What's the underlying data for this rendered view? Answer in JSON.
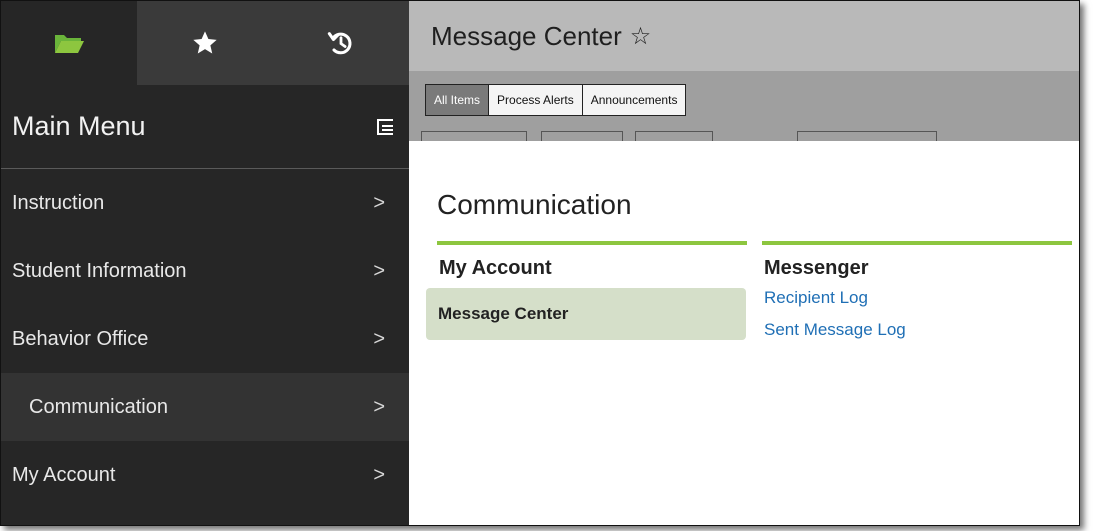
{
  "icons": {
    "tab_folder": "folder-icon",
    "tab_star": "star-icon",
    "tab_history": "history-icon",
    "menu_tree": "tree-list-icon",
    "chevron": "chevron-right-icon",
    "title_star": "star-outline-icon"
  },
  "colors": {
    "sidebar_bg": "#262626",
    "accent_green": "#8dc63f",
    "folder_green": "#7ac943",
    "link_blue": "#1f6fb5",
    "highlight_bg": "#d5dfc9"
  },
  "sidebar": {
    "menu_title": "Main Menu",
    "items": [
      {
        "label": "Instruction",
        "chevron": ">"
      },
      {
        "label": "Student Information",
        "chevron": ">"
      },
      {
        "label": "Behavior Office",
        "chevron": ">"
      },
      {
        "label": "Communication",
        "chevron": ">"
      },
      {
        "label": "My Account",
        "chevron": ">"
      }
    ]
  },
  "header": {
    "title": "Message Center",
    "star": "☆"
  },
  "subtabs": [
    "All Items",
    "Process Alerts",
    "Announcements"
  ],
  "content": {
    "section_title": "Communication",
    "columns": [
      {
        "header": "My Account",
        "items": [
          "Message Center"
        ]
      },
      {
        "header": "Messenger",
        "items": [
          "Recipient Log",
          "Sent Message Log"
        ]
      }
    ]
  }
}
